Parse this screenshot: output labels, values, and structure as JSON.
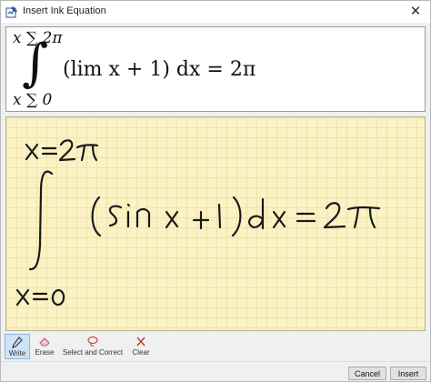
{
  "window": {
    "title": "Insert Ink Equation",
    "close_glyph": "✕",
    "title_icon": "ink-equation-icon"
  },
  "preview": {
    "upper_limit": "x ∑ 2π",
    "lower_limit": "x ∑ 0",
    "integral_sign": "∫",
    "body": "(lim x + 1) dx = 2π"
  },
  "ink": {
    "handwritten_content": "∫ from x=0 to x=2π of (sin x + 1) dx = 2π",
    "ink_color": "#1a1a1a",
    "paper_color": "#fbf2c5"
  },
  "toolbar": {
    "tools": [
      {
        "label": "Write",
        "icon": "pen-icon",
        "active": true
      },
      {
        "label": "Erase",
        "icon": "eraser-icon",
        "active": false
      },
      {
        "label": "Select and Correct",
        "icon": "lasso-icon",
        "active": false
      },
      {
        "label": "Clear",
        "icon": "clear-icon",
        "active": false
      }
    ]
  },
  "buttons": {
    "cancel": "Cancel",
    "insert": "Insert"
  }
}
